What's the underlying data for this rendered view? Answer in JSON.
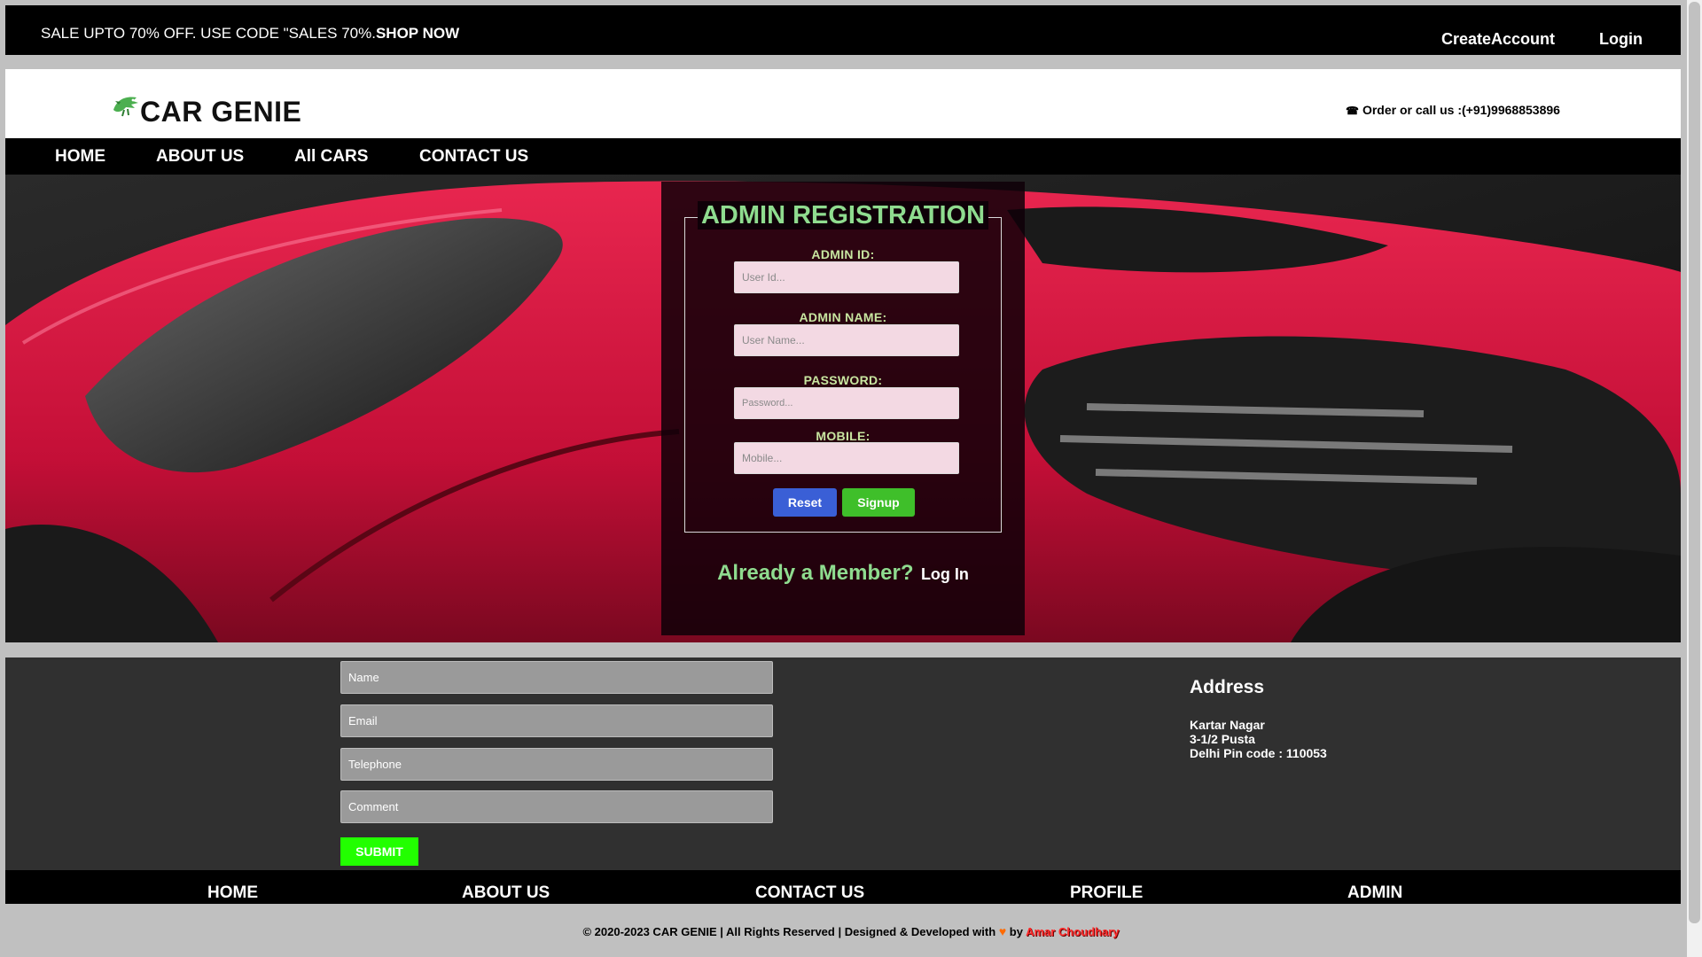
{
  "promo": {
    "sale_text": "SALE UPTO 70% OFF. USE CODE \"SALES 70%.",
    "shop_now": "SHOP NOW",
    "create_account": "CreateAccount",
    "login": "Login"
  },
  "header": {
    "brand": "CAR GENIE",
    "logo_icon": "dragon-icon",
    "phone_icon": "telephone-icon",
    "order_text": "Order or call us :(+91)9968853896"
  },
  "nav": {
    "items": [
      "HOME",
      "ABOUT US",
      "All CARS",
      "CONTACT US"
    ]
  },
  "registration": {
    "title": "ADMIN REGISTRATION",
    "admin_id_label": "ADMIN ID:",
    "admin_id_placeholder": "User Id...",
    "admin_name_label": "ADMIN NAME:",
    "admin_name_placeholder": "User Name...",
    "password_label": "PASSWORD:",
    "password_placeholder": "Password...",
    "mobile_label": "MOBILE:",
    "mobile_placeholder": "Mobile...",
    "reset": "Reset",
    "signup": "Signup",
    "already_member": "Already a Member?",
    "login_link": "Log In"
  },
  "contact_form": {
    "name_placeholder": "Name",
    "email_placeholder": "Email",
    "telephone_placeholder": "Telephone",
    "comment_placeholder": "Comment",
    "submit": "SUBMIT"
  },
  "address": {
    "title": "Address",
    "lines": [
      "Kartar Nagar",
      "3-1/2 Pusta",
      "Delhi Pin code : 110053"
    ]
  },
  "footer_nav": {
    "items": [
      "HOME",
      "ABOUT US",
      "CONTACT US",
      "PROFILE",
      "ADMIN"
    ]
  },
  "copyright": {
    "text": "© 2020-2023 CAR GENIE | All Rights Reserved | Designed & Developed with",
    "heart_icon": "heart-icon",
    "by": "by",
    "author": "Amar Choudhary"
  },
  "colors": {
    "accent_green": "#8fdc8f",
    "submit_green": "#22ff00",
    "reset_blue": "#3a5fd6",
    "signup_green": "#3fbf2a",
    "car_red": "#d1103c"
  }
}
